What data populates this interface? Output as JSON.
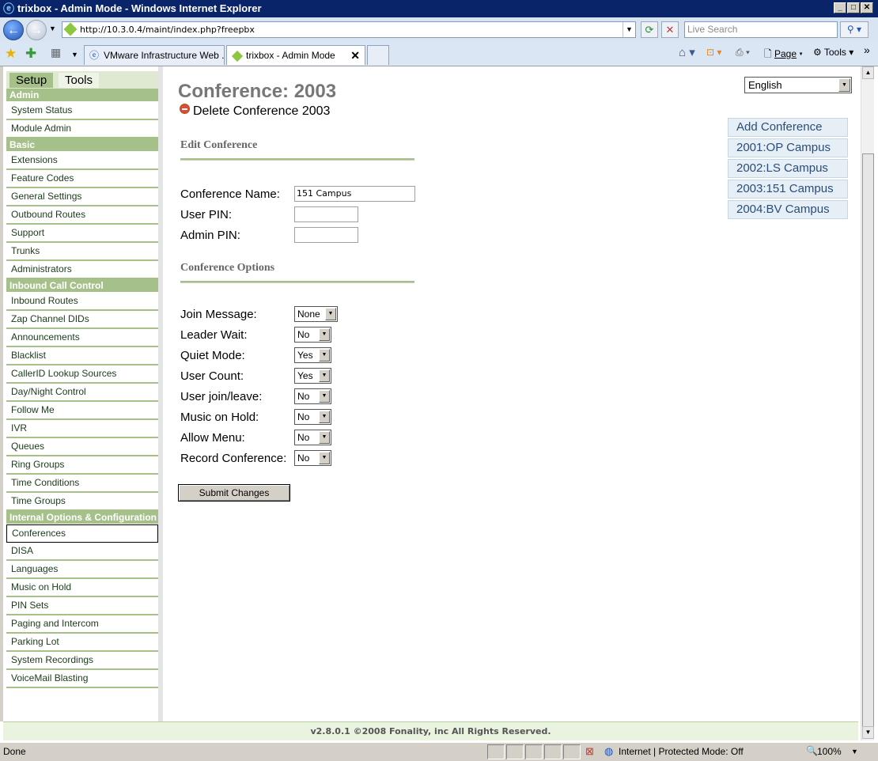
{
  "window": {
    "title": "trixbox - Admin Mode - Windows Internet Explorer"
  },
  "browser": {
    "url": "http://10.3.0.4/maint/index.php?freepbx",
    "search_placeholder": "Live Search",
    "tabs": [
      {
        "label": "VMware Infrastructure Web ..."
      },
      {
        "label": "trixbox - Admin Mode"
      }
    ],
    "commands": {
      "page": "Page",
      "tools": "Tools"
    }
  },
  "sidebar": {
    "tabs": {
      "setup": "Setup",
      "tools": "Tools"
    },
    "sections": {
      "admin": "Admin",
      "basic": "Basic",
      "inbound": "Inbound Call Control",
      "internal": "Internal Options & Configuration"
    },
    "admin_items": [
      "System Status",
      "Module Admin"
    ],
    "basic_items": [
      "Extensions",
      "Feature Codes",
      "General Settings",
      "Outbound Routes",
      "Support",
      "Trunks",
      "Administrators"
    ],
    "inbound_items": [
      "Inbound Routes",
      "Zap Channel DIDs",
      "Announcements",
      "Blacklist",
      "CallerID Lookup Sources",
      "Day/Night Control",
      "Follow Me",
      "IVR",
      "Queues",
      "Ring Groups",
      "Time Conditions",
      "Time Groups"
    ],
    "internal_items": [
      "Conferences",
      "DISA",
      "Languages",
      "Music on Hold",
      "PIN Sets",
      "Paging and Intercom",
      "Parking Lot",
      "System Recordings",
      "VoiceMail Blasting"
    ]
  },
  "main": {
    "title": "Conference: 2003",
    "delete_label": "Delete Conference 2003",
    "edit_section": "Edit Conference",
    "fields": {
      "name_label": "Conference Name:",
      "name_value": "151 Campus",
      "user_pin_label": "User PIN:",
      "admin_pin_label": "Admin PIN:"
    },
    "options_section": "Conference Options",
    "options": [
      {
        "label": "Join Message:",
        "value": "None"
      },
      {
        "label": "Leader Wait:",
        "value": "No"
      },
      {
        "label": "Quiet Mode:",
        "value": "Yes"
      },
      {
        "label": "User Count:",
        "value": "Yes"
      },
      {
        "label": "User join/leave:",
        "value": "No"
      },
      {
        "label": "Music on Hold:",
        "value": "No"
      },
      {
        "label": "Allow Menu:",
        "value": "No"
      },
      {
        "label": "Record Conference:",
        "value": "No"
      }
    ],
    "submit_label": "Submit Changes"
  },
  "language": {
    "selected": "English"
  },
  "right_nav": [
    "Add Conference",
    "2001:OP Campus",
    "2002:LS Campus",
    "2003:151 Campus",
    "2004:BV Campus"
  ],
  "footer": "v2.8.0.1 ©2008 Fonality, inc All Rights Reserved.",
  "status": {
    "text": "Done",
    "zone": "Internet | Protected Mode: Off",
    "zoom": "100%"
  },
  "colors": {
    "section_green": "#a6c08a",
    "title_bar": "#0a246a"
  }
}
